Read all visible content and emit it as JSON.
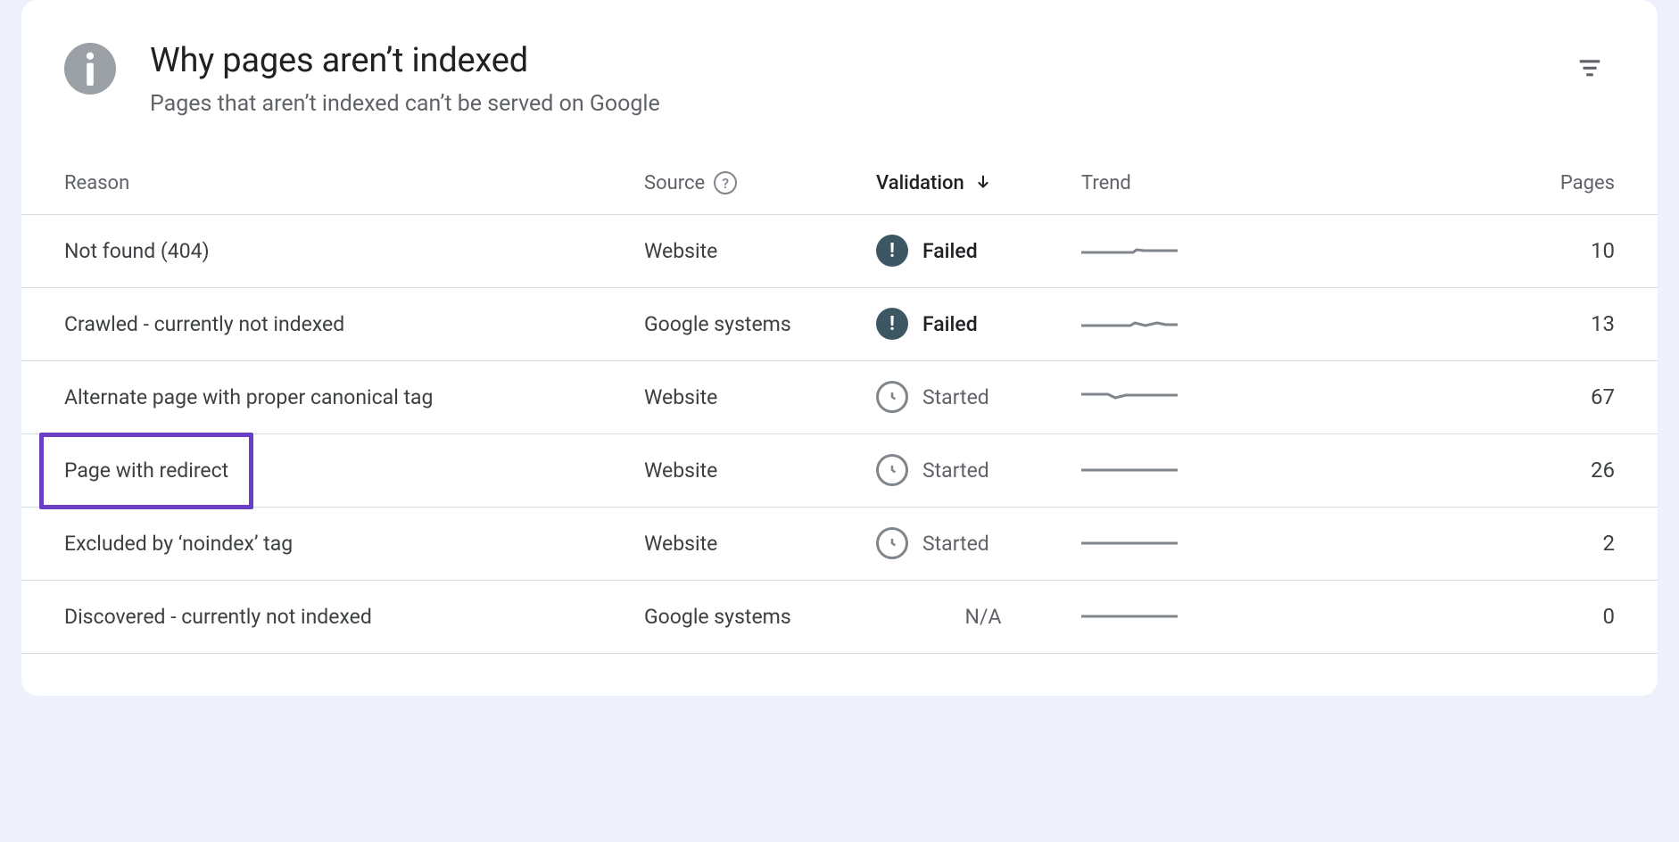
{
  "header": {
    "title": "Why pages aren’t indexed",
    "subtitle": "Pages that aren’t indexed can’t be served on Google"
  },
  "columns": {
    "reason": "Reason",
    "source": "Source",
    "validation": "Validation",
    "trend": "Trend",
    "pages": "Pages"
  },
  "rows": [
    {
      "reason": "Not found (404)",
      "source": "Website",
      "validation": "Failed",
      "status": "failed",
      "trend": "flat-bump",
      "pages": "10",
      "highlighted": false
    },
    {
      "reason": "Crawled - currently not indexed",
      "source": "Google systems",
      "validation": "Failed",
      "status": "failed",
      "trend": "wavy",
      "pages": "13",
      "highlighted": false
    },
    {
      "reason": "Alternate page with proper canonical tag",
      "source": "Website",
      "validation": "Started",
      "status": "started",
      "trend": "dip",
      "pages": "67",
      "highlighted": false
    },
    {
      "reason": "Page with redirect",
      "source": "Website",
      "validation": "Started",
      "status": "started",
      "trend": "flat",
      "pages": "26",
      "highlighted": true
    },
    {
      "reason": "Excluded by ‘noindex’ tag",
      "source": "Website",
      "validation": "Started",
      "status": "started",
      "trend": "flat",
      "pages": "2",
      "highlighted": false
    },
    {
      "reason": "Discovered - currently not indexed",
      "source": "Google systems",
      "validation": "N/A",
      "status": "na",
      "trend": "flat",
      "pages": "0",
      "highlighted": false
    }
  ]
}
